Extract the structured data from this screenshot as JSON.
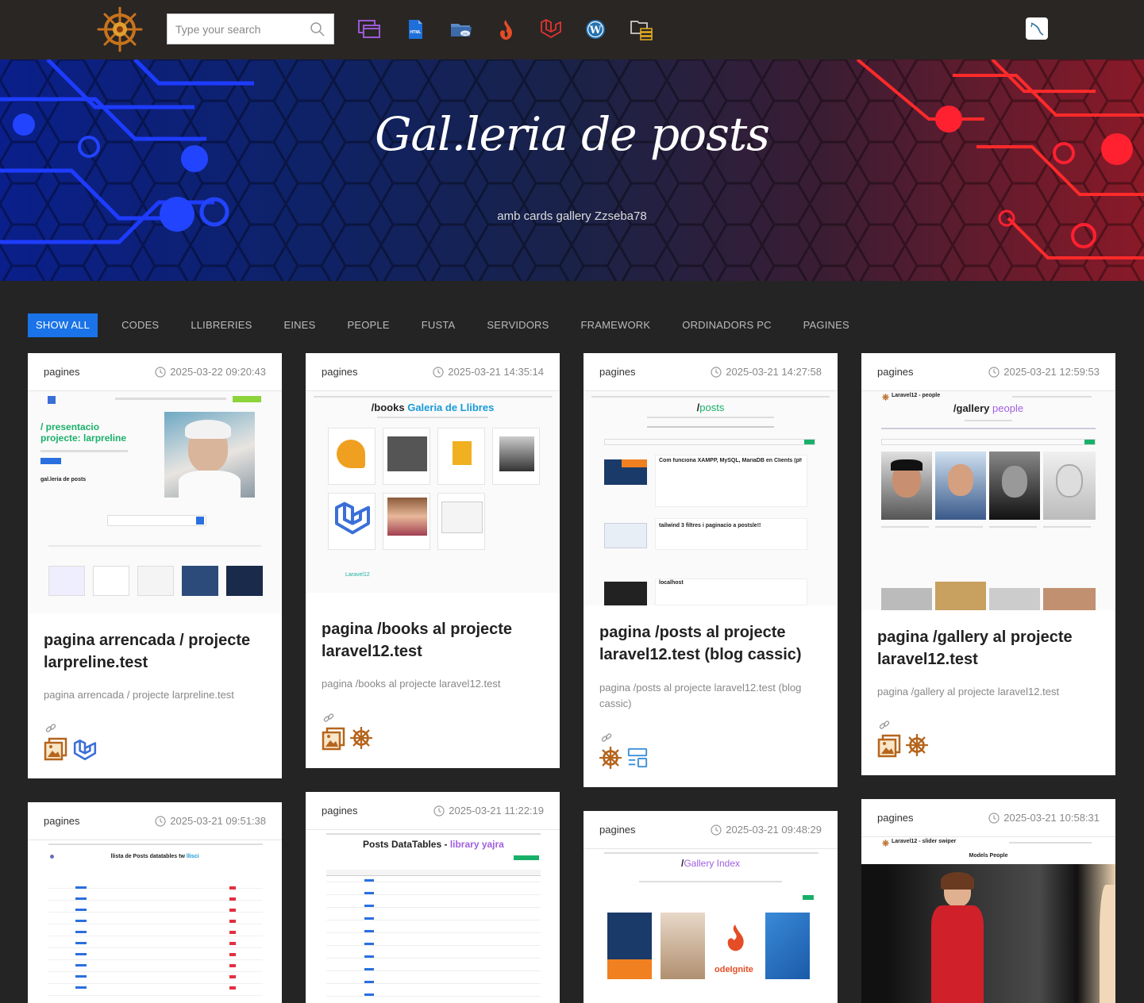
{
  "search": {
    "placeholder": "Type your search"
  },
  "nav": {
    "icons": [
      "windows-icon",
      "html-file-icon",
      "php-folder-icon",
      "codeigniter-icon",
      "laravel-icon",
      "wordpress-icon",
      "folder-server-icon"
    ],
    "mysql_icon": "mysql-workbench-icon"
  },
  "hero": {
    "title": "Gal.leria de posts",
    "subtitle": "amb cards gallery Zzseba78"
  },
  "filters": [
    "SHOW ALL",
    "CODES",
    "LLIBRERIES",
    "EINES",
    "PEOPLE",
    "FUSTA",
    "SERVIDORS",
    "FRAMEWORK",
    "ORDINADORS PC",
    "PAGINES"
  ],
  "cards": [
    {
      "category": "pagines",
      "date": "2025-03-22 09:20:43",
      "title": "pagina arrencada / projecte larpreline.test",
      "excerpt": "pagina arrencada / projecte larpreline.test",
      "thumb": {
        "line1": "/ presentacio",
        "line2": "projecte: larpreline",
        "section": "gal.leria de posts"
      },
      "icons": [
        "gallery-icon",
        "laravel-icon"
      ]
    },
    {
      "category": "pagines",
      "date": "2025-03-21 14:35:14",
      "title": "pagina /books al projecte laravel12.test",
      "excerpt": "pagina /books al projecte laravel12.test",
      "thumb": {
        "heading_a": "/books",
        "heading_b": "Galeria de Llibres",
        "footer": "Laravel12"
      },
      "icons": [
        "gallery-icon",
        "ship-wheel-icon"
      ]
    },
    {
      "category": "pagines",
      "date": "2025-03-21 14:27:58",
      "title": "pagina /posts al projecte laravel12.test (blog cassic)",
      "excerpt": "pagina /posts al projecte laravel12.test (blog cassic)",
      "thumb": {
        "heading_a": "/",
        "heading_b": "posts",
        "post1": "Com funciona XAMPP, MySQL, MariaDB en Clients (phpMyAdmin, Workbench, TablePlus)",
        "post2": "tailwind 3 filtres i paginacio a postsle!!",
        "post3": "localhost"
      },
      "icons": [
        "ship-wheel-icon",
        "layout-icon"
      ]
    },
    {
      "category": "pagines",
      "date": "2025-03-21 12:59:53",
      "title": "pagina /gallery al projecte laravel12.test",
      "excerpt": "pagina /gallery al projecte laravel12.test",
      "thumb": {
        "brand": "Laravel12 - people",
        "heading_a": "/gallery",
        "heading_b": "people"
      },
      "icons": [
        "gallery-icon",
        "ship-wheel-icon"
      ]
    },
    {
      "category": "pagines",
      "date": "2025-03-21 09:51:38",
      "thumb": {
        "heading_a": "llista de Posts datatables tw",
        "heading_b": "llisci"
      }
    },
    {
      "category": "pagines",
      "date": "2025-03-21 11:22:19",
      "thumb": {
        "heading_a": "Posts DataTables - ",
        "heading_b": "library yajra"
      }
    },
    {
      "category": "pagines",
      "date": "2025-03-21 09:48:29",
      "thumb": {
        "heading_a": "/",
        "heading_b": "Gallery Index",
        "caption": "odeIgnite"
      }
    },
    {
      "category": "pagines",
      "date": "2025-03-21 10:58:31",
      "thumb": {
        "brand": "Laravel12 - slider swiper",
        "heading": "Models People"
      }
    }
  ],
  "colors": {
    "accent": "#1a73e8",
    "topbar": "#2a2624",
    "background": "#242424",
    "icon_brown": "#b5651d",
    "laravel_blue": "#3b6fd8"
  }
}
